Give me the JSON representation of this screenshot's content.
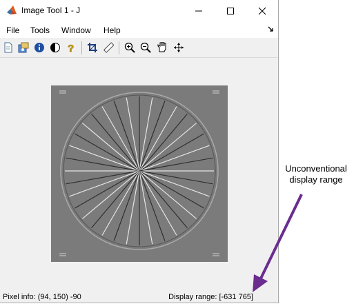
{
  "window": {
    "title": "Image Tool 1 - J",
    "controls": {
      "minimize": "minimize",
      "maximize": "maximize",
      "close": "close"
    }
  },
  "menu": [
    "File",
    "Tools",
    "Window",
    "Help"
  ],
  "toolbar": {
    "icons": [
      "new-figure-icon",
      "export-icon",
      "image-info-icon",
      "contrast-icon",
      "help-icon",
      "crop-icon",
      "measure-distance-icon",
      "zoom-in-icon",
      "zoom-out-icon",
      "pan-icon",
      "overview-icon"
    ]
  },
  "status": {
    "pixel_info": "Pixel info: (94, 150)  -90",
    "display_range": "Display range: [-631 765]"
  },
  "annotation": {
    "line1": "Unconventional",
    "line2": "display range"
  },
  "colors": {
    "arrow": "#6a2d8f",
    "image_background": "#7b7b7b"
  }
}
